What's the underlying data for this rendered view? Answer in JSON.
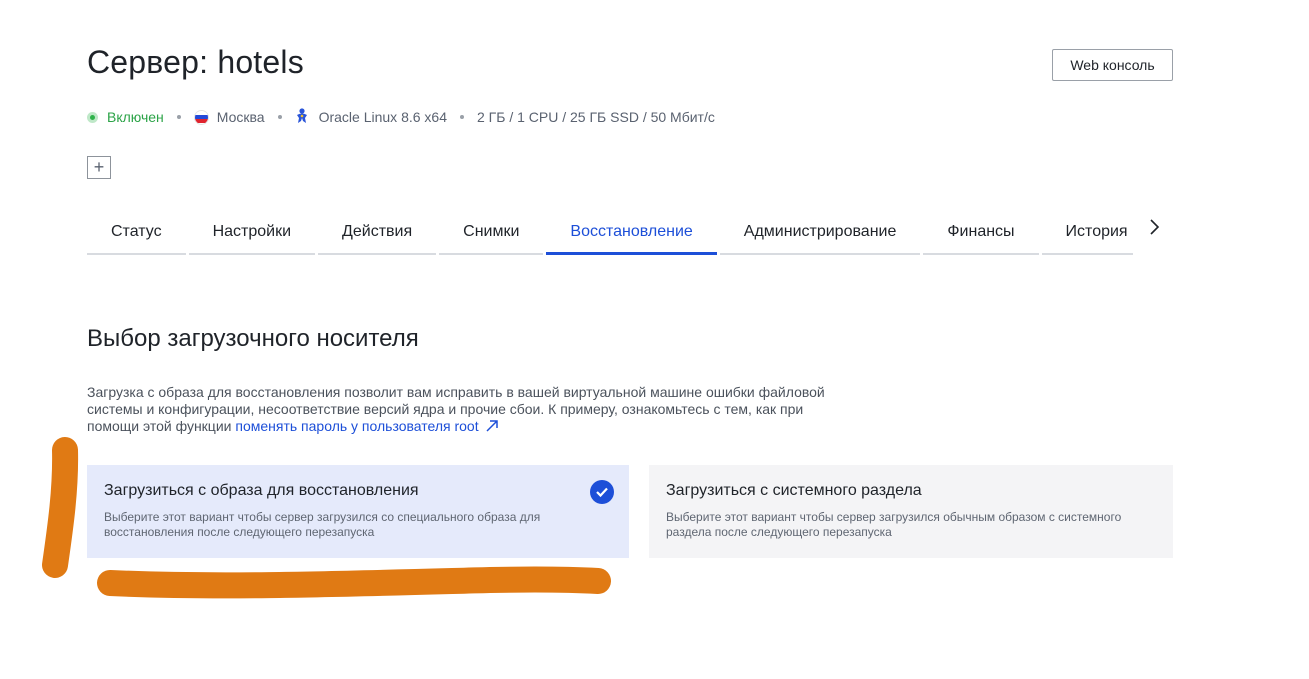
{
  "header": {
    "title": "Сервер: hotels",
    "web_console_label": "Web консоль"
  },
  "meta": {
    "status": "Включен",
    "location": "Москва",
    "os": "Oracle Linux 8.6 x64",
    "specs": "2 ГБ / 1 CPU / 25 ГБ SSD / 50 Мбит/с"
  },
  "add_button_label": "+",
  "tabs": [
    {
      "label": "Статус"
    },
    {
      "label": "Настройки"
    },
    {
      "label": "Действия"
    },
    {
      "label": "Снимки"
    },
    {
      "label": "Восстановление",
      "active": true
    },
    {
      "label": "Администрирование"
    },
    {
      "label": "Финансы"
    },
    {
      "label": "История"
    }
  ],
  "section": {
    "title": "Выбор загрузочного носителя",
    "desc_text": "Загрузка с образа для восстановления позволит вам исправить в вашей виртуальной машине ошибки файловой системы и конфигурации, несоответствие версий ядра и прочие сбои. К примеру, ознакомьтесь с тем, как при помощи этой функции ",
    "desc_link": "поменять пароль у пользователя root"
  },
  "options": [
    {
      "title": "Загрузиться с образа для восстановления",
      "desc": "Выберите этот вариант чтобы сервер загрузился со специального образа для восстановления после следующего перезапуска",
      "selected": true
    },
    {
      "title": "Загрузиться с системного раздела",
      "desc": "Выберите этот вариант чтобы сервер загрузился обычным образом с системного раздела после следующего перезапуска",
      "selected": false
    }
  ],
  "colors": {
    "accent": "#1d4fd8",
    "status_green": "#2ba347",
    "selected_card_bg": "#e5eafb",
    "plain_card_bg": "#f4f4f6",
    "scribble": "#e07a14"
  },
  "icons": {
    "status": "status-dot-icon",
    "location": "russia-flag-icon",
    "os": "oracle-linux-icon",
    "add": "plus-icon",
    "tabs_next": "chevron-right-icon",
    "external_link": "external-link-arrow-icon",
    "selected": "check-circle-icon"
  }
}
